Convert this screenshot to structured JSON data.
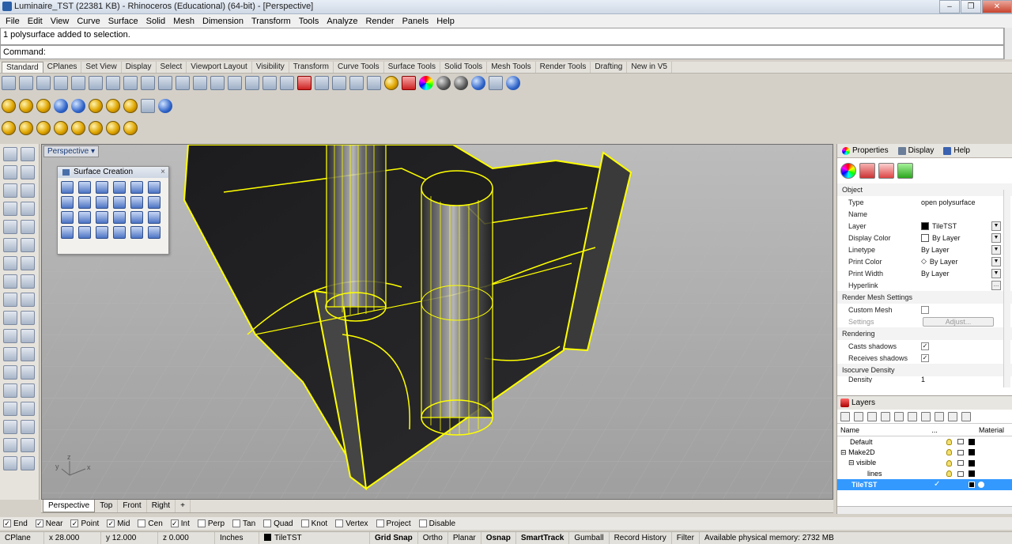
{
  "window": {
    "title": "Luminaire_TST (22381 KB) - Rhinoceros (Educational) (64-bit) - [Perspective]",
    "controls": [
      "–",
      "❐",
      "✕"
    ]
  },
  "menu": [
    "File",
    "Edit",
    "View",
    "Curve",
    "Surface",
    "Solid",
    "Mesh",
    "Dimension",
    "Transform",
    "Tools",
    "Analyze",
    "Render",
    "Panels",
    "Help"
  ],
  "command": {
    "history": "1 polysurface added to selection.",
    "prompt": "Command:",
    "value": ""
  },
  "toolbar_tabs": [
    "Standard",
    "CPlanes",
    "Set View",
    "Display",
    "Select",
    "Viewport Layout",
    "Visibility",
    "Transform",
    "Curve Tools",
    "Surface Tools",
    "Solid Tools",
    "Mesh Tools",
    "Render Tools",
    "Drafting",
    "New in V5"
  ],
  "toolbar_tabs_active": "Standard",
  "viewport": {
    "label": "Perspective",
    "axis_x": "x",
    "axis_y": "y",
    "axis_z": "z"
  },
  "surface_panel": {
    "title": "Surface Creation",
    "close": "×"
  },
  "viewport_tabs": [
    "Perspective",
    "Top",
    "Front",
    "Right"
  ],
  "viewport_tab_add": "+",
  "properties": {
    "tabs": [
      "Properties",
      "Display",
      "Help"
    ],
    "section_object": "Object",
    "rows": [
      {
        "key": "Type",
        "value": "open polysurface"
      },
      {
        "key": "Name",
        "value": ""
      },
      {
        "key": "Layer",
        "value": "TileTST"
      },
      {
        "key": "Display Color",
        "value": "By Layer"
      },
      {
        "key": "Linetype",
        "value": "By Layer"
      },
      {
        "key": "Print Color",
        "value": "By Layer"
      },
      {
        "key": "Print Width",
        "value": "By Layer"
      },
      {
        "key": "Hyperlink",
        "value": ""
      }
    ],
    "section_render": "Render Mesh Settings",
    "custom_mesh": "Custom Mesh",
    "settings": "Settings",
    "adjust": "Adjust...",
    "section_rendering": "Rendering",
    "casts_shadows": "Casts shadows",
    "receives_shadows": "Receives shadows",
    "section_iso": "Isocurve Density",
    "density": "Density",
    "density_value": "1"
  },
  "layers": {
    "title": "Layers",
    "col_name": "Name",
    "col_mid": "...",
    "col_material": "Material",
    "rows": [
      {
        "name": "Default",
        "indent": 1,
        "prefix": ""
      },
      {
        "name": "Make2D",
        "indent": 0,
        "prefix": "⊟"
      },
      {
        "name": "visible",
        "indent": 1,
        "prefix": "⊟"
      },
      {
        "name": "lines",
        "indent": 3,
        "prefix": ""
      },
      {
        "name": "TileTST",
        "indent": 1,
        "prefix": "",
        "selected": true
      }
    ]
  },
  "osnaps": [
    {
      "label": "End",
      "checked": true
    },
    {
      "label": "Near",
      "checked": true
    },
    {
      "label": "Point",
      "checked": true
    },
    {
      "label": "Mid",
      "checked": true
    },
    {
      "label": "Cen",
      "checked": false
    },
    {
      "label": "Int",
      "checked": true
    },
    {
      "label": "Perp",
      "checked": false
    },
    {
      "label": "Tan",
      "checked": false
    },
    {
      "label": "Quad",
      "checked": false
    },
    {
      "label": "Knot",
      "checked": false
    },
    {
      "label": "Vertex",
      "checked": false
    },
    {
      "label": "Project",
      "checked": false
    },
    {
      "label": "Disable",
      "checked": false
    }
  ],
  "status": {
    "cplane": "CPlane",
    "x": "x 28.000",
    "y": "y 12.000",
    "z": "z 0.000",
    "units": "Inches",
    "layer": "TileTST",
    "grid_snap": "Grid Snap",
    "ortho": "Ortho",
    "planar": "Planar",
    "osnap": "Osnap",
    "smarttrack": "SmartTrack",
    "gumball": "Gumball",
    "record_history": "Record History",
    "filter": "Filter",
    "memory": "Available physical memory: 2732 MB"
  },
  "colors": {
    "selection": "#ffff00",
    "layer_black": "#000000",
    "selected_row": "#3399ff"
  }
}
